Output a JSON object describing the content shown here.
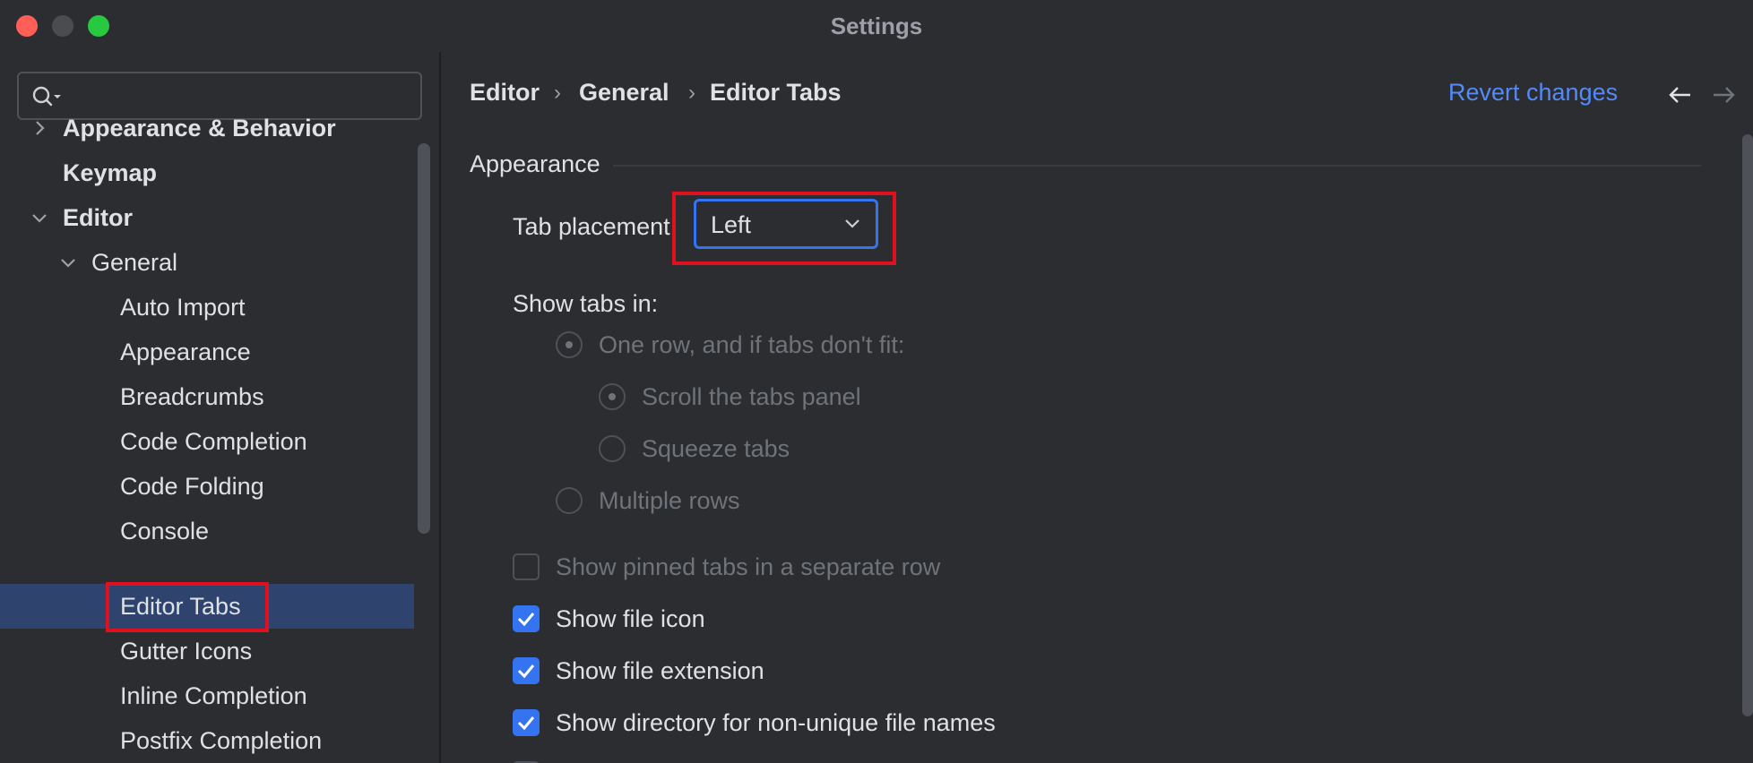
{
  "window": {
    "title": "Settings"
  },
  "sidebar": {
    "search": {
      "placeholder": "",
      "value": ""
    },
    "items": [
      {
        "label": "Appearance & Behavior",
        "level": 0,
        "expanded": false,
        "has_children": true,
        "bold": true
      },
      {
        "label": "Keymap",
        "level": 0,
        "has_children": false,
        "bold": true
      },
      {
        "label": "Editor",
        "level": 0,
        "expanded": true,
        "has_children": true,
        "bold": true
      },
      {
        "label": "General",
        "level": 1,
        "expanded": true,
        "has_children": true
      },
      {
        "label": "Auto Import",
        "level": 2
      },
      {
        "label": "Appearance",
        "level": 2
      },
      {
        "label": "Breadcrumbs",
        "level": 2
      },
      {
        "label": "Code Completion",
        "level": 2
      },
      {
        "label": "Code Folding",
        "level": 2
      },
      {
        "label": "Console",
        "level": 2
      },
      {
        "label": "Editor Tabs",
        "level": 2,
        "selected": true
      },
      {
        "label": "Gutter Icons",
        "level": 2
      },
      {
        "label": "Inline Completion",
        "level": 2
      },
      {
        "label": "Postfix Completion",
        "level": 2
      }
    ]
  },
  "header": {
    "breadcrumbs": [
      "Editor",
      "General",
      "Editor Tabs"
    ],
    "separator": "›",
    "revert_label": "Revert changes"
  },
  "appearance": {
    "section_title": "Appearance",
    "tab_placement_label": "Tab placement:",
    "tab_placement_value": "Left",
    "show_tabs_in_label": "Show tabs in:",
    "radio_one_row": "One row, and if tabs don't fit:",
    "radio_scroll": "Scroll the tabs panel",
    "radio_squeeze": "Squeeze tabs",
    "radio_multiple": "Multiple rows",
    "check_pinned": "Show pinned tabs in a separate row",
    "check_file_icon": "Show file icon",
    "check_file_extension": "Show file extension",
    "check_directory": "Show directory for non-unique file names"
  },
  "colors": {
    "accent": "#3574f0",
    "selection": "#2e436e",
    "link": "#548af7",
    "highlight": "#e0101e"
  }
}
